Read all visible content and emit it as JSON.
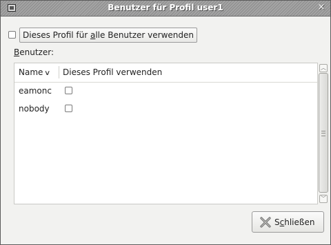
{
  "window": {
    "title": "Benutzer für Profil user1",
    "close_glyph": "×"
  },
  "option": {
    "label_pre": "Dieses Profil für ",
    "label_mnemonic": "a",
    "label_post": "lle Benutzer verwenden",
    "checked": false
  },
  "users_label": {
    "mnemonic": "B",
    "rest": "enutzer:"
  },
  "table": {
    "columns": {
      "name": "Name",
      "sort_glyph": "∨",
      "use": "Dieses Profil verwenden"
    },
    "rows": [
      {
        "name": "eamonc",
        "checked": false
      },
      {
        "name": "nobody",
        "checked": false
      }
    ]
  },
  "close_button": {
    "pre": "S",
    "mnemonic": "c",
    "post": "hließen"
  },
  "icons": {
    "window_menu": "window-menu-icon",
    "close_window": "close-icon",
    "close_button": "x-close-icon",
    "sort": "chevron-down-icon"
  }
}
